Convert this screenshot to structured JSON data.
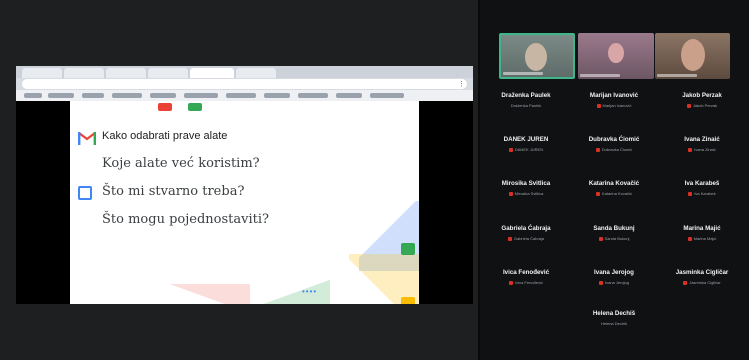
{
  "slide": {
    "title": "Kako odabrati prave alate",
    "lines": [
      "Koje alate već koristim?",
      "Što mi stvarno treba?",
      "Što mogu pojednostaviti?"
    ]
  },
  "colors": {
    "gmail_red": "#ea4335",
    "google_blue": "#4285f4",
    "google_green": "#34a853",
    "google_yellow": "#fbbc04",
    "speaker_border": "#3fb58a",
    "muted_red": "#d93025"
  },
  "participants": [
    {
      "name": "Draženka Paulek",
      "muted": false
    },
    {
      "name": "Marijan Ivanović",
      "muted": true
    },
    {
      "name": "Jakob Perzak",
      "muted": true
    },
    {
      "name": "DANEK JUREN",
      "muted": true
    },
    {
      "name": "Dubravka Ćiomić",
      "muted": true
    },
    {
      "name": "Ivana Zinaić",
      "muted": true
    },
    {
      "name": "Mirosika Svitlica",
      "muted": true
    },
    {
      "name": "Katarina Kovačić",
      "muted": true
    },
    {
      "name": "Iva Karabeš",
      "muted": true
    },
    {
      "name": "Gabriela Ćabraja",
      "muted": true
    },
    {
      "name": "Sanda Bukunj",
      "muted": true
    },
    {
      "name": "Marina Majić",
      "muted": true
    },
    {
      "name": "Ivica Fenođević",
      "muted": true
    },
    {
      "name": "Ivana Jerojog",
      "muted": true
    },
    {
      "name": "Jasminka Cigličar",
      "muted": true
    },
    {
      "name": "Helena Dechiš",
      "muted": false
    }
  ]
}
